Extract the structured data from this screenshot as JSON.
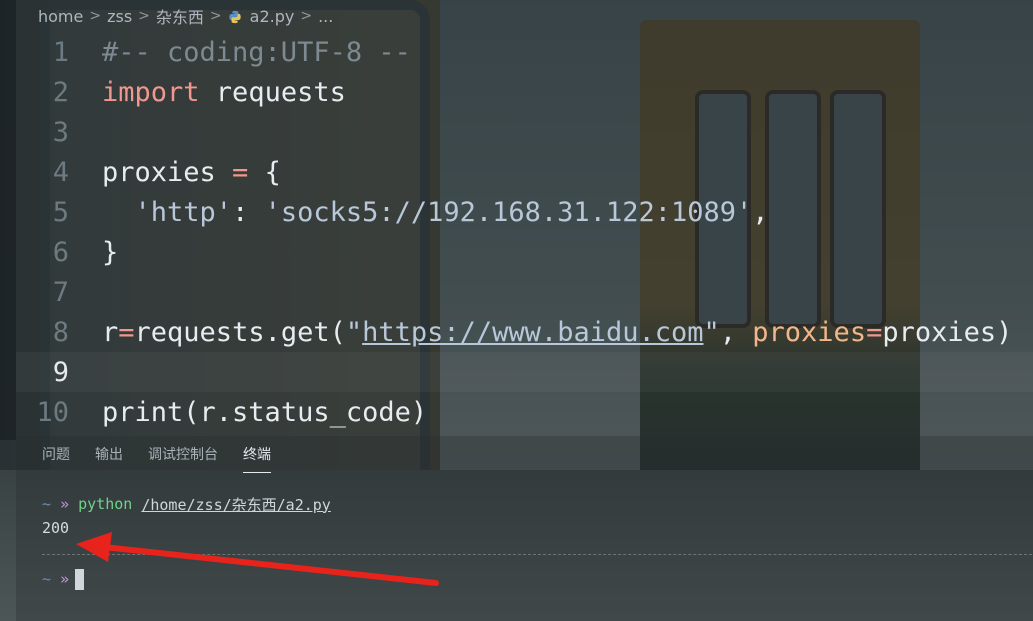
{
  "breadcrumb": {
    "home": "home",
    "zss": "zss",
    "folder": "杂东西",
    "file": "a2.py",
    "more": "..."
  },
  "editor": {
    "lines": [
      {
        "n": "1"
      },
      {
        "n": "2"
      },
      {
        "n": "3"
      },
      {
        "n": "4"
      },
      {
        "n": "5"
      },
      {
        "n": "6"
      },
      {
        "n": "7"
      },
      {
        "n": "8"
      },
      {
        "n": "9"
      },
      {
        "n": "10"
      }
    ],
    "code": {
      "l1": "#-- coding:UTF-8 --",
      "l2_kw": "import",
      "l2_rest": " requests",
      "l4_a": "proxies",
      "l4_op": " = ",
      "l4_b": "{",
      "l5_indent": "  ",
      "l5_key": "'http'",
      "l5_colon": ": ",
      "l5_val": "'socks5://192.168.31.122:1089'",
      "l5_comma": ",",
      "l6": "}",
      "l8_a": "r",
      "l8_op": "=",
      "l8_b": "requests.get(",
      "l8_q1": "\"",
      "l8_url": "https://www.baidu.com",
      "l8_q2": "\"",
      "l8_c": ", ",
      "l8_param": "proxies",
      "l8_op2": "=",
      "l8_d": "proxies)",
      "l10_fn": "print",
      "l10_rest": "(r.status_code)"
    }
  },
  "panel": {
    "tabs": [
      "问题",
      "输出",
      "调试控制台",
      "终端"
    ],
    "active_tab": "终端"
  },
  "terminal": {
    "prompt_tilde": "~",
    "prompt_arrow": "»",
    "cmd": "python",
    "path": "/home/zss/杂东西/a2.py",
    "output": "200"
  },
  "colors": {
    "annotation_arrow": "#e8231c",
    "keyword": "#f2978f",
    "string": "#b9c8d8",
    "terminal_cmd": "#6fd28a"
  }
}
